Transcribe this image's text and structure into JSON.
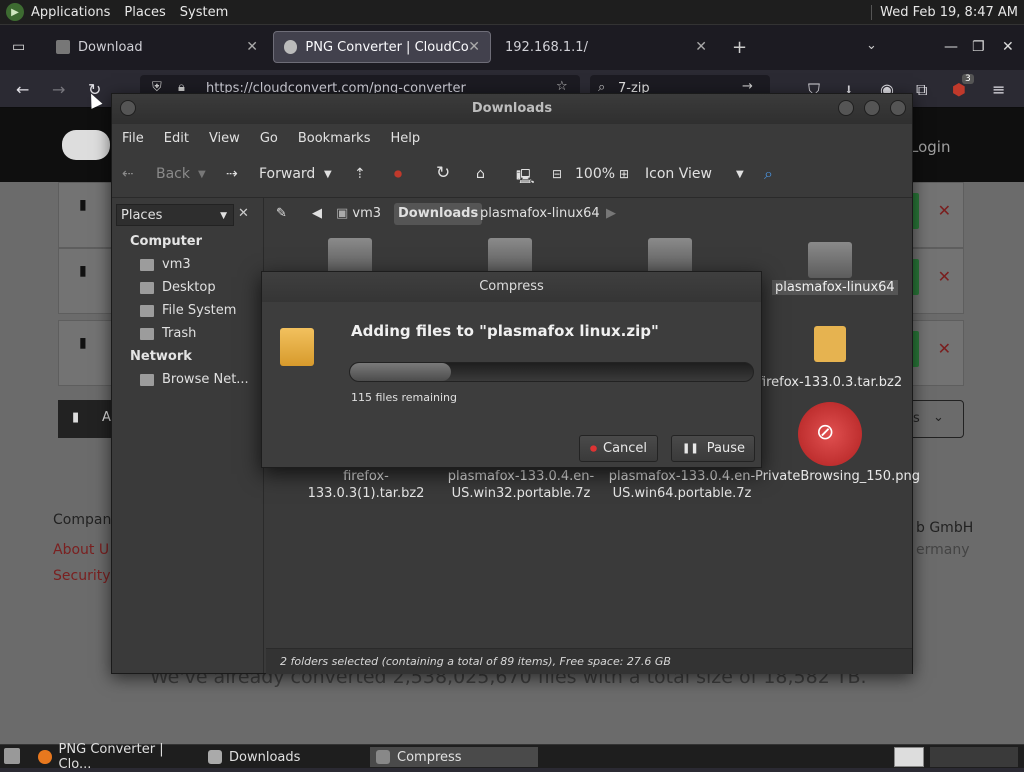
{
  "top_panel": {
    "menu": [
      "Applications",
      "Places",
      "System"
    ],
    "clock": "Wed Feb 19,  8:47 AM"
  },
  "browser": {
    "tabs": [
      {
        "label": "Download"
      },
      {
        "label": "PNG Converter | CloudConv"
      },
      {
        "label": "192.168.1.1/"
      }
    ],
    "url": "https://cloudconvert.com/png-converter",
    "search_value": "7-zip",
    "extension_badge": "3"
  },
  "website": {
    "login_label": "Login",
    "footer": {
      "heading": "Compan",
      "links": [
        "About U",
        "Security"
      ],
      "company_right": "b GmbH",
      "country_right": "ermany"
    },
    "converted_text": "We've already converted 2,538,025,670 files with a total size of 18,582 TB.",
    "dropdown_partial": "es",
    "add_button_partial": "A"
  },
  "file_manager": {
    "title": "Downloads",
    "menu": [
      "File",
      "Edit",
      "View",
      "Go",
      "Bookmarks",
      "Help"
    ],
    "toolbar": {
      "back": "Back",
      "forward": "Forward",
      "zoom": "100%",
      "view_mode": "Icon View"
    },
    "pathbar": [
      "vm3",
      "Downloads",
      "plasmafox-linux64"
    ],
    "sidebar": {
      "selector": "Places",
      "computer_heading": "Computer",
      "computer_items": [
        "vm3",
        "Desktop",
        "File System",
        "Trash"
      ],
      "network_heading": "Network",
      "network_items": [
        "Browse Net..."
      ]
    },
    "files": {
      "folder_selected": "plasmafox-linux64",
      "firefox_133": "firefox-133.0.3.tar.bz2",
      "firefox_133_1": "firefox-133.0.3(1).tar.bz2",
      "plasmafox_win32": "plasmafox-133.0.4.en-US.win32.portable.7z",
      "plasmafox_win64": "plasmafox-133.0.4.en-US.win64.portable.7z",
      "private_png": "PrivateBrowsing_150.png"
    },
    "status": "2 folders selected (containing a total of 89 items), Free space: 27.6 GB"
  },
  "compress_dialog": {
    "title": "Compress",
    "heading": "Adding files to \"plasmafox linux.zip\"",
    "progress": 0.25,
    "remaining": "115 files remaining",
    "cancel_label": "Cancel",
    "pause_label": "Pause"
  },
  "taskbar": {
    "items": [
      "PNG Converter | Clo...",
      "Downloads",
      "Compress"
    ]
  }
}
